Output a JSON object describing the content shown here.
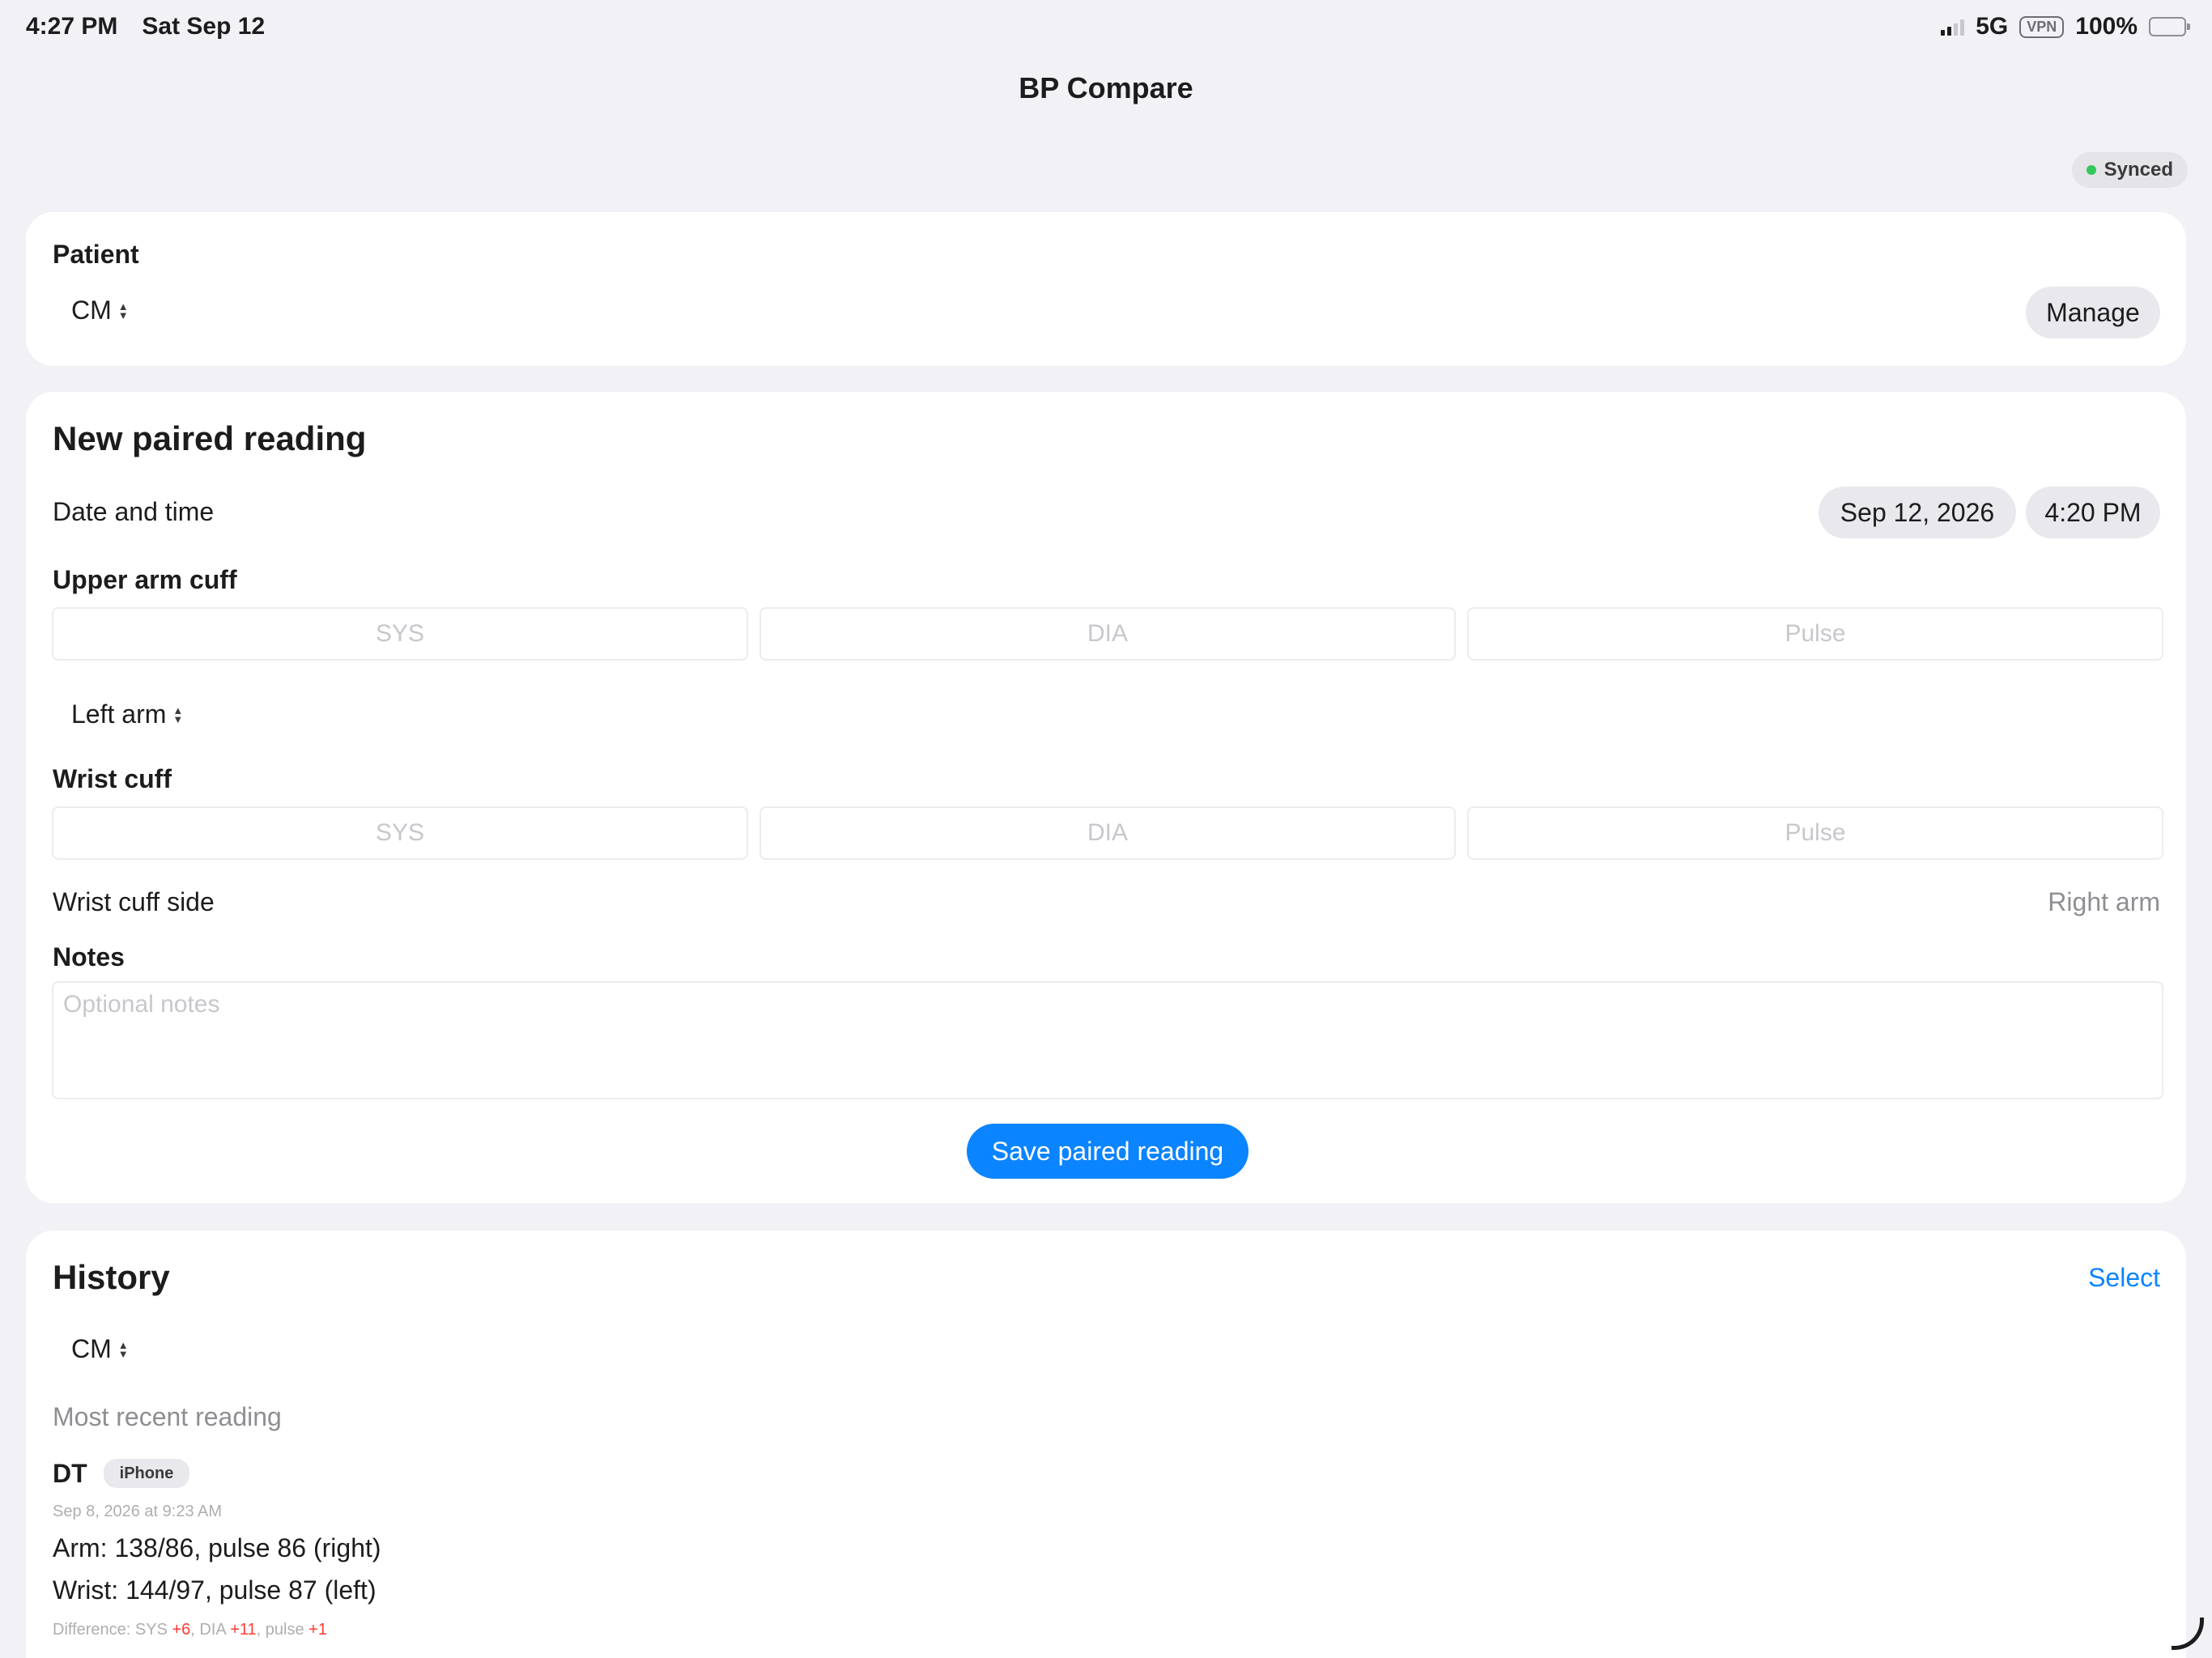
{
  "status_bar": {
    "time": "4:27 PM",
    "date": "Sat Sep 12",
    "network": "5G",
    "vpn": "VPN",
    "battery": "100%"
  },
  "nav": {
    "title": "BP Compare"
  },
  "sync": {
    "label": "Synced",
    "color": "#34c759"
  },
  "patient": {
    "heading": "Patient",
    "selected": "CM",
    "manage_label": "Manage"
  },
  "new_reading": {
    "title": "New paired reading",
    "date_time_label": "Date and time",
    "date_value": "Sep 12, 2026",
    "time_value": "4:20 PM",
    "upper_arm": {
      "heading": "Upper arm cuff",
      "sys_placeholder": "SYS",
      "dia_placeholder": "DIA",
      "pulse_placeholder": "Pulse",
      "side": "Left arm"
    },
    "wrist": {
      "heading": "Wrist cuff",
      "sys_placeholder": "SYS",
      "dia_placeholder": "DIA",
      "pulse_placeholder": "Pulse",
      "side_label": "Wrist cuff side",
      "side_value": "Right arm"
    },
    "notes": {
      "heading": "Notes",
      "placeholder": "Optional notes"
    },
    "save_label": "Save paired reading",
    "accent": "#0a84ff"
  },
  "history": {
    "title": "History",
    "select_label": "Select",
    "patient_filter": "CM",
    "section_label": "Most recent reading",
    "entry": {
      "initials": "DT",
      "device": "iPhone",
      "timestamp": "Sep 8, 2026 at 9:23 AM",
      "arm_line": "Arm: 138/86, pulse 86 (right)",
      "wrist_line": "Wrist: 144/97, pulse 87 (left)",
      "diff_prefix": "Difference: SYS ",
      "diff_sys": "+6",
      "diff_dia_label": ", DIA ",
      "diff_dia": "+11",
      "diff_pulse_label": ", pulse ",
      "diff_pulse": "+1"
    }
  }
}
